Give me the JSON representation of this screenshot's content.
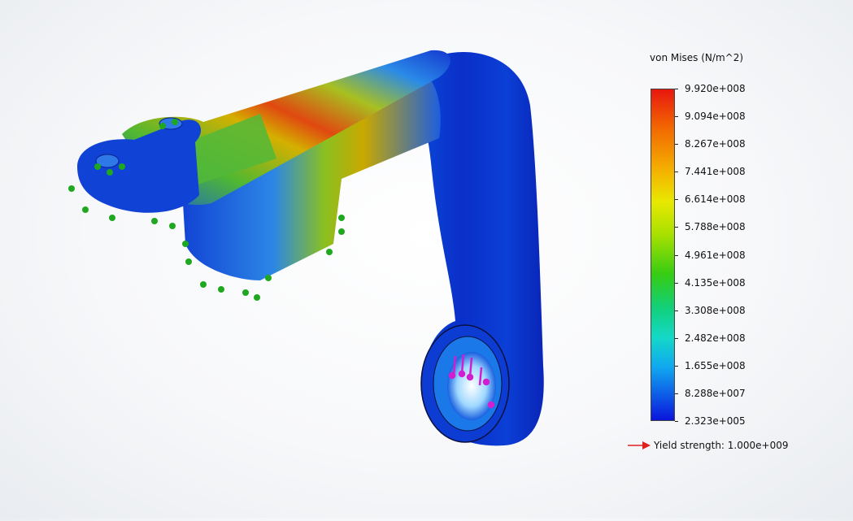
{
  "legend": {
    "title": "von Mises (N/m^2)",
    "ticks": [
      "9.920e+008",
      "9.094e+008",
      "8.267e+008",
      "7.441e+008",
      "6.614e+008",
      "5.788e+008",
      "4.961e+008",
      "4.135e+008",
      "3.308e+008",
      "2.482e+008",
      "1.655e+008",
      "8.288e+007",
      "2.323e+005"
    ],
    "yield_label": "Yield strength: 1.000e+009",
    "yield_arrow_color": "#e02020"
  },
  "colors": {
    "max": "#e8170f",
    "mid": "#35cc14",
    "min": "#0a14dc",
    "fixture": "#1fa81f",
    "load": "#d01fd0"
  }
}
